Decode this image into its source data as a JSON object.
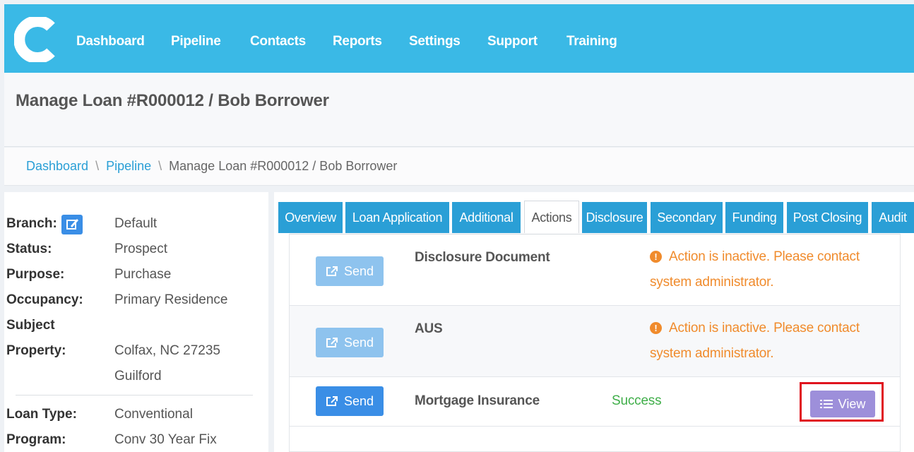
{
  "app": {
    "logo_letter": "C",
    "nav": [
      "Dashboard",
      "Pipeline",
      "Contacts",
      "Reports",
      "Settings",
      "Support",
      "Training"
    ]
  },
  "page": {
    "title": "Manage Loan #R000012 / Bob Borrower"
  },
  "breadcrumb": {
    "items": [
      "Dashboard",
      "Pipeline"
    ],
    "current": "Manage Loan #R000012 / Bob Borrower",
    "separator": "\\"
  },
  "loan_info": {
    "rows": [
      {
        "label": "Branch:",
        "value": "Default"
      },
      {
        "label": "Status:",
        "value": "Prospect"
      },
      {
        "label": "Purpose:",
        "value": "Purchase"
      },
      {
        "label": "Occupancy:",
        "value": "Primary Residence"
      },
      {
        "label": "Subject",
        "value": ""
      },
      {
        "label": "Property:",
        "value": "Colfax, NC 27235"
      },
      {
        "label": "",
        "value": "Guilford"
      },
      {
        "label": "Loan Type:",
        "value": "Conventional"
      },
      {
        "label": "Program:",
        "value": "Conv 30 Year Fix"
      }
    ]
  },
  "tabs": [
    "Overview",
    "Loan Application",
    "Additional",
    "Actions",
    "Disclosure",
    "Secondary",
    "Funding",
    "Post Closing",
    "Audit"
  ],
  "active_tab": "Actions",
  "actions": [
    {
      "send_label": "Send",
      "name": "Disclosure Document",
      "status_type": "warning",
      "status": "Action is inactive. Please contact system administrator."
    },
    {
      "send_label": "Send",
      "name": "AUS",
      "status_type": "warning",
      "status": "Action is inactive. Please contact system administrator."
    },
    {
      "send_label": "Send",
      "name": "Mortgage Insurance",
      "status_type": "success",
      "status": "Success",
      "view_label": "View"
    }
  ],
  "colors": {
    "nav_bg": "#3ab9e6",
    "tab_bg": "#2a9fd6",
    "warning": "#f08b2c",
    "success": "#3fae49",
    "view_btn": "#9d8fda",
    "highlight": "#e0141e"
  }
}
